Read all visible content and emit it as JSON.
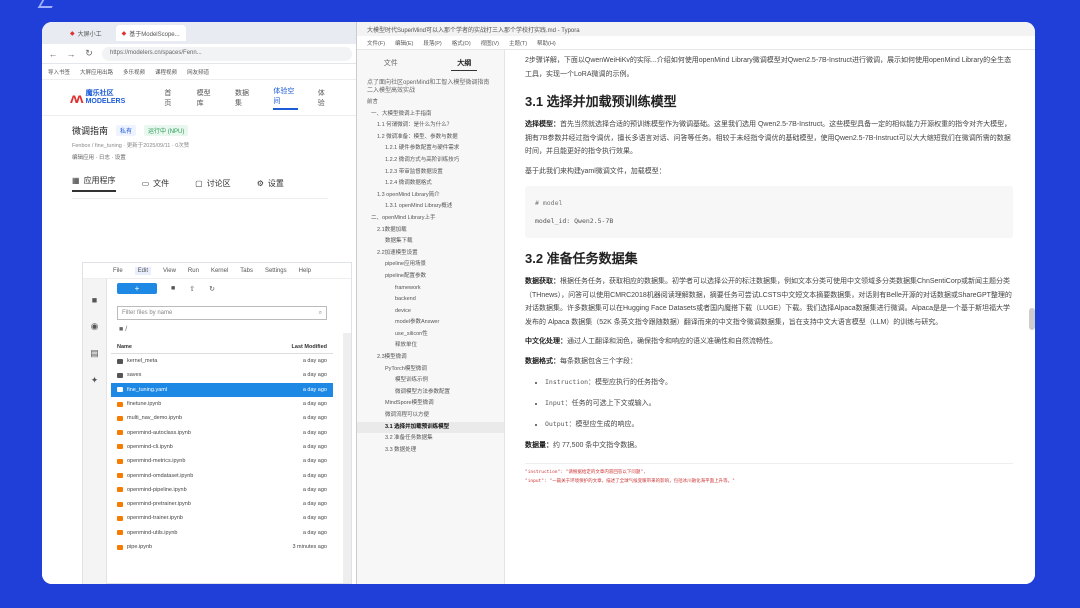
{
  "browser": {
    "tabs": [
      "大屏小工",
      "基于ModelScope..."
    ],
    "url": "https://modelers.cn/spaces/Fenn...",
    "bookmarks": [
      "导入书签",
      "大屏应用出路",
      "多乐视频",
      "课程视频",
      "网友频道"
    ]
  },
  "site": {
    "logo_text": "魔乐社区 MODELERS",
    "nav": [
      "首页",
      "模型库",
      "数据集",
      "体验空间",
      "体验"
    ]
  },
  "space": {
    "title": "微调指南",
    "tag1": "私有",
    "tag2": "运行中 (NPU)",
    "meta": "Fenbox / fine_tuning  ·  更新于2025/09/11  ·  0次赞",
    "meta2": "编辑应用  ·  日志  ·  设置",
    "tabs": [
      "应用程序",
      "文件",
      "讨论区",
      "设置"
    ]
  },
  "jupyter": {
    "menu": [
      "File",
      "Edit",
      "View",
      "Run",
      "Kernel",
      "Tabs",
      "Settings",
      "Help"
    ],
    "new_label": "+",
    "filter_placeholder": "Filter files by name",
    "path": "/",
    "col_name": "Name",
    "col_modified": "Last Modified",
    "files": [
      {
        "name": "kernel_meta",
        "mod": "a day ago",
        "type": "folder"
      },
      {
        "name": "saves",
        "mod": "a day ago",
        "type": "folder"
      },
      {
        "name": "fine_tuning.yaml",
        "mod": "a day ago",
        "type": "yaml"
      },
      {
        "name": "finetune.ipynb",
        "mod": "a day ago",
        "type": "nb"
      },
      {
        "name": "multi_nav_demo.ipynb",
        "mod": "a day ago",
        "type": "nb"
      },
      {
        "name": "openmind-autoclass.ipynb",
        "mod": "a day ago",
        "type": "nb"
      },
      {
        "name": "openmind-cli.ipynb",
        "mod": "a day ago",
        "type": "nb"
      },
      {
        "name": "openmind-metrics.ipynb",
        "mod": "a day ago",
        "type": "nb"
      },
      {
        "name": "openmind-omdataset.ipynb",
        "mod": "a day ago",
        "type": "nb"
      },
      {
        "name": "openmind-pipeline.ipynb",
        "mod": "a day ago",
        "type": "nb"
      },
      {
        "name": "openmind-pretrainer.ipynb",
        "mod": "a day ago",
        "type": "nb"
      },
      {
        "name": "openmind-trainer.ipynb",
        "mod": "a day ago",
        "type": "nb"
      },
      {
        "name": "openmind-utils.ipynb",
        "mod": "a day ago",
        "type": "nb"
      },
      {
        "name": "pipe.ipynb",
        "mod": "3 minutes ago",
        "type": "nb"
      }
    ]
  },
  "typora": {
    "title": "大模型时代SuperMind可以入那个学者的实战打三入那个学校打实践.md - Typora",
    "menu": [
      "文件(F)",
      "编辑(E)",
      "段落(P)",
      "格式(O)",
      "视图(V)",
      "主题(T)",
      "帮助(H)"
    ],
    "outline_tabs": [
      "文件",
      "大纲"
    ],
    "outline_intro": "点了面向社区openMind和工智入模型微调指南二入模型高效实战",
    "outline": [
      {
        "text": "前言",
        "lvl": 0
      },
      {
        "text": "一、大模型微调上手指南",
        "lvl": 1
      },
      {
        "text": "1.1 何谓微调：是什么为什么？",
        "lvl": 2
      },
      {
        "text": "1.2 微调准备：模型、参数与数据",
        "lvl": 2
      },
      {
        "text": "1.2.1 硬件参数配置与硬件需求",
        "lvl": 3
      },
      {
        "text": "1.2.2 微调方式与高阶训练技巧",
        "lvl": 3
      },
      {
        "text": "1.2.3 带审监督数据设置",
        "lvl": 3
      },
      {
        "text": "1.2.4 微调数据格式",
        "lvl": 3
      },
      {
        "text": "1.3 openMind Library简介",
        "lvl": 2
      },
      {
        "text": "1.3.1 openMind Library概述",
        "lvl": 3
      },
      {
        "text": "二、openMind Library上手",
        "lvl": 1
      },
      {
        "text": "2.1数据加载",
        "lvl": 2
      },
      {
        "text": "数据集下载",
        "lvl": 3
      },
      {
        "text": "2.2加速模型设置",
        "lvl": 2
      },
      {
        "text": "pipeline应用场景",
        "lvl": 3
      },
      {
        "text": "pipeline配置参数",
        "lvl": 3
      },
      {
        "text": "framework",
        "lvl": 4
      },
      {
        "text": "backend",
        "lvl": 4
      },
      {
        "text": "device",
        "lvl": 4
      },
      {
        "text": "model参数Answer",
        "lvl": 4
      },
      {
        "text": "use_silicon性",
        "lvl": 4
      },
      {
        "text": "释放单位",
        "lvl": 4
      },
      {
        "text": "2.3模型微调",
        "lvl": 2
      },
      {
        "text": "PyTorch模型微调",
        "lvl": 3
      },
      {
        "text": "模型训练示例",
        "lvl": 4
      },
      {
        "text": "微调模型方法参数配置",
        "lvl": 4
      },
      {
        "text": "MindSpore模型微调",
        "lvl": 3
      },
      {
        "text": "微调流程可以方便",
        "lvl": 3
      },
      {
        "text": "3.1 选择并加载预训练模型",
        "lvl": 3,
        "active": true
      },
      {
        "text": "3.2 准备任务数据集",
        "lvl": 3
      },
      {
        "text": "3.3 数据处理",
        "lvl": 3
      }
    ]
  },
  "doc": {
    "intro": "2步骤详解，下面以QwenWeiHiKv的实际...介绍如何使用openMind Library微调模型对Qwen2.5-7B-Instruct进行微调，展示如何使用openMind Library的全生态工具，实现一个LoRA微调的示例。",
    "h31": "3.1 选择并加载预训练模型",
    "p1_lead": "选择模型：",
    "p1": "首先当然就选择合适的预训练模型作为微调基础。这里我们选用 Qwen2.5-7B-Instruct。这些模型具备一定的相似能力开源权重的指令对齐大模型，拥有7B参数并经过指令调优，擅长多语言对话、问答等任务。相较于未经指令调优的基础模型，使用Qwen2.5-7B-Instruct可以大大缩短我们在微调所需的数据时间，并且能更好的指令执行效果。",
    "p2": "基于此我们来构建yaml微调文件，加载模型：",
    "code_comment": "# model",
    "code_line": "model_id: Qwen2.5-7B",
    "h32": "3.2 准备任务数据集",
    "p3_lead": "数据获取：",
    "p3": "根据任务任务，获取相应的数据集。初学者可以选择公开的标注数据集，例如文本分类可使用中文领域多分类数据集ChnSentiCorp或新闻主题分类（THnews），问答可以使用CMRC2018机器阅读理解数据，摘要任务可尝试LCSTS中文短文本摘要数据集，对话则有Belle开源的对话数据或ShareGPT整理的对话数据集。许多数据集可以在Hugging Face Datasets或者国内魔搭下载（LUGE）下载。我们选择Alpaca数据集进行微调。Alpaca是是一个基于斯坦福大学发布的 Alpaca 数据集（52K 条英文指令跟随数据）翻译而来的中文指令微调数据集，旨在支持中文大语言模型（LLM）的训练与研究。",
    "p4_lead": "中文化处理：",
    "p4": "通过人工翻译和润色，确保指令和响应的语义准确性和自然流畅性。",
    "p5_lead": "数据格式：",
    "p5": "每条数据包含三个字段：",
    "bullets": [
      {
        "code": "Instruction",
        "text": "：模型应执行的任务指令。"
      },
      {
        "code": "Input",
        "text": "：任务的可选上下文或输入。"
      },
      {
        "code": "Output",
        "text": "：模型应生成的响应。"
      }
    ],
    "p6_lead": "数据量：",
    "p6": "约 77,500 条中文指令数据。",
    "note1": "\"instruction\": \"请根据给定的文章内容回答以下问题\",",
    "note2": "\"input\": \"一篇关于环境保护的文章，描述了全球气候变暖带来的影响，包括冰川融化海平面上升等。\""
  }
}
